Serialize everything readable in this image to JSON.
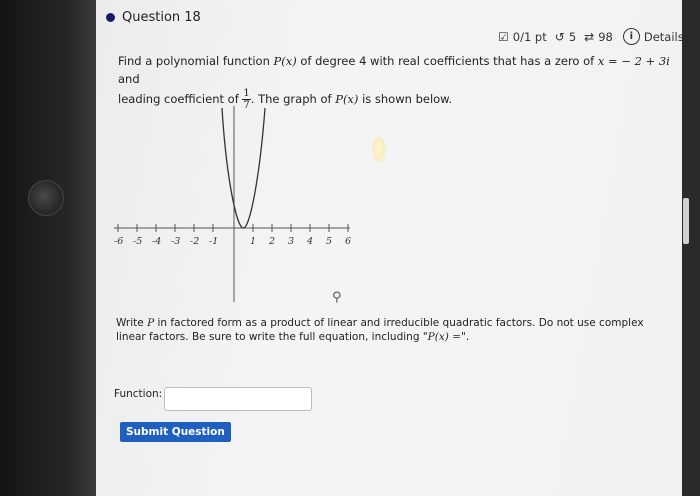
{
  "question": {
    "title": "Question 18",
    "score": "0/1 pt",
    "retries": "5",
    "attempts": "98",
    "details": "Details"
  },
  "prompt": {
    "line1_a": "Find a polynomial function",
    "line1_fn": "P(x)",
    "line1_b": "of degree 4 with real coefficients that has a zero of",
    "line1_zero": "x = − 2 + 3i",
    "line1_c": "and",
    "line2_a": "leading coefficient of",
    "frac_num": "1",
    "frac_den": "7",
    "line2_b": ". The graph of",
    "line2_fn": "P(x)",
    "line2_c": "is shown below."
  },
  "graph": {
    "x_ticks_neg": [
      "-6",
      "-5",
      "-4",
      "-3",
      "-2",
      "-1"
    ],
    "x_ticks_pos": [
      "1",
      "2",
      "3",
      "4",
      "5",
      "6"
    ]
  },
  "instructions": {
    "text_a": "Write",
    "var": "P",
    "text_b": "in factored form as a product of linear and irreducible quadratic factors. Do not use complex linear factors. Be sure to write the full equation, including \"",
    "eq": "P(x) =",
    "text_c": "\"."
  },
  "answer": {
    "label": "Function:",
    "value": ""
  },
  "submit_label": "Submit Question"
}
